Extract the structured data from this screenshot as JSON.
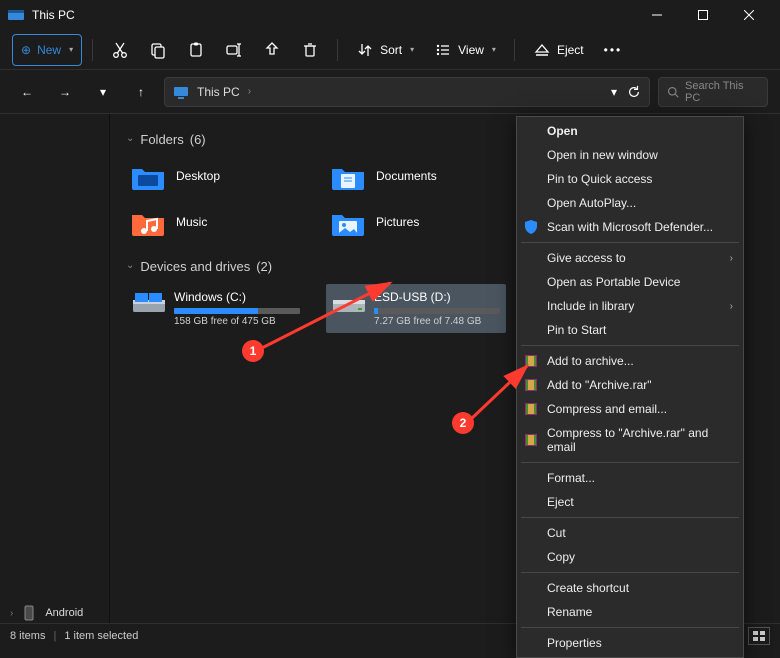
{
  "titlebar": {
    "title": "This PC"
  },
  "toolbar": {
    "new_label": "New",
    "sort_label": "Sort",
    "view_label": "View",
    "eject_label": "Eject"
  },
  "address": {
    "crumb": "This PC"
  },
  "search": {
    "placeholder": "Search This PC"
  },
  "groups": {
    "folders": {
      "label": "Folders",
      "count": "(6)"
    },
    "devices": {
      "label": "Devices and drives",
      "count": "(2)"
    }
  },
  "folders": [
    {
      "name": "Desktop"
    },
    {
      "name": "Documents"
    },
    {
      "name": "Music"
    },
    {
      "name": "Pictures"
    }
  ],
  "drives": [
    {
      "name": "Windows (C:)",
      "free": "158 GB free of 475 GB",
      "pct": 67
    },
    {
      "name": "ESD-USB (D:)",
      "free": "7.27 GB free of 7.48 GB",
      "pct": 3
    }
  ],
  "tree": {
    "bottom_item": "Android"
  },
  "context_menu": {
    "g1": [
      "Open",
      "Open in new window",
      "Pin to Quick access",
      "Open AutoPlay...",
      "Scan with Microsoft Defender..."
    ],
    "g2": [
      "Give access to",
      "Open as Portable Device",
      "Include in library",
      "Pin to Start"
    ],
    "g3": [
      "Add to archive...",
      "Add to \"Archive.rar\"",
      "Compress and email...",
      "Compress to \"Archive.rar\" and email"
    ],
    "g4": [
      "Format...",
      "Eject"
    ],
    "g5": [
      "Cut",
      "Copy"
    ],
    "g6": [
      "Create shortcut",
      "Rename"
    ],
    "g7": [
      "Properties"
    ]
  },
  "statusbar": {
    "items": "8 items",
    "selected": "1 item selected"
  },
  "callouts": {
    "one": "1",
    "two": "2"
  }
}
